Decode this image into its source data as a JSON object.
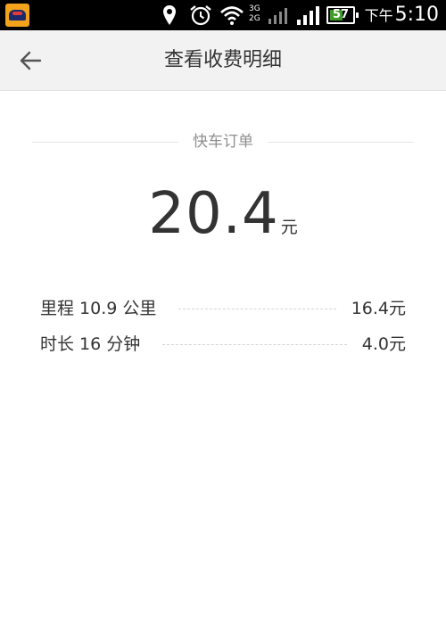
{
  "status_bar": {
    "network_top": "3G",
    "network_bottom": "2G",
    "battery_level": "57",
    "battery_fraction": 0.57,
    "ampm": "下午",
    "time": "5:10",
    "icons": [
      "app-icon",
      "location-icon",
      "alarm-icon",
      "wifi-icon",
      "signal-icon",
      "battery-icon"
    ]
  },
  "header": {
    "title": "查看收费明细",
    "back_icon": "arrow-left-icon"
  },
  "order": {
    "type_label": "快车订单",
    "total_amount": "20.4",
    "total_unit": "元"
  },
  "fees": [
    {
      "name": "里程 10.9 公里",
      "amount": "16.4元"
    },
    {
      "name": "时长 16 分钟",
      "amount": "4.0元"
    }
  ],
  "colors": {
    "status_bar": "#000000",
    "header_bg": "#f2f2f2",
    "text_primary": "#333333",
    "text_secondary": "#8f8f8f",
    "battery_green": "#3f9a28"
  }
}
